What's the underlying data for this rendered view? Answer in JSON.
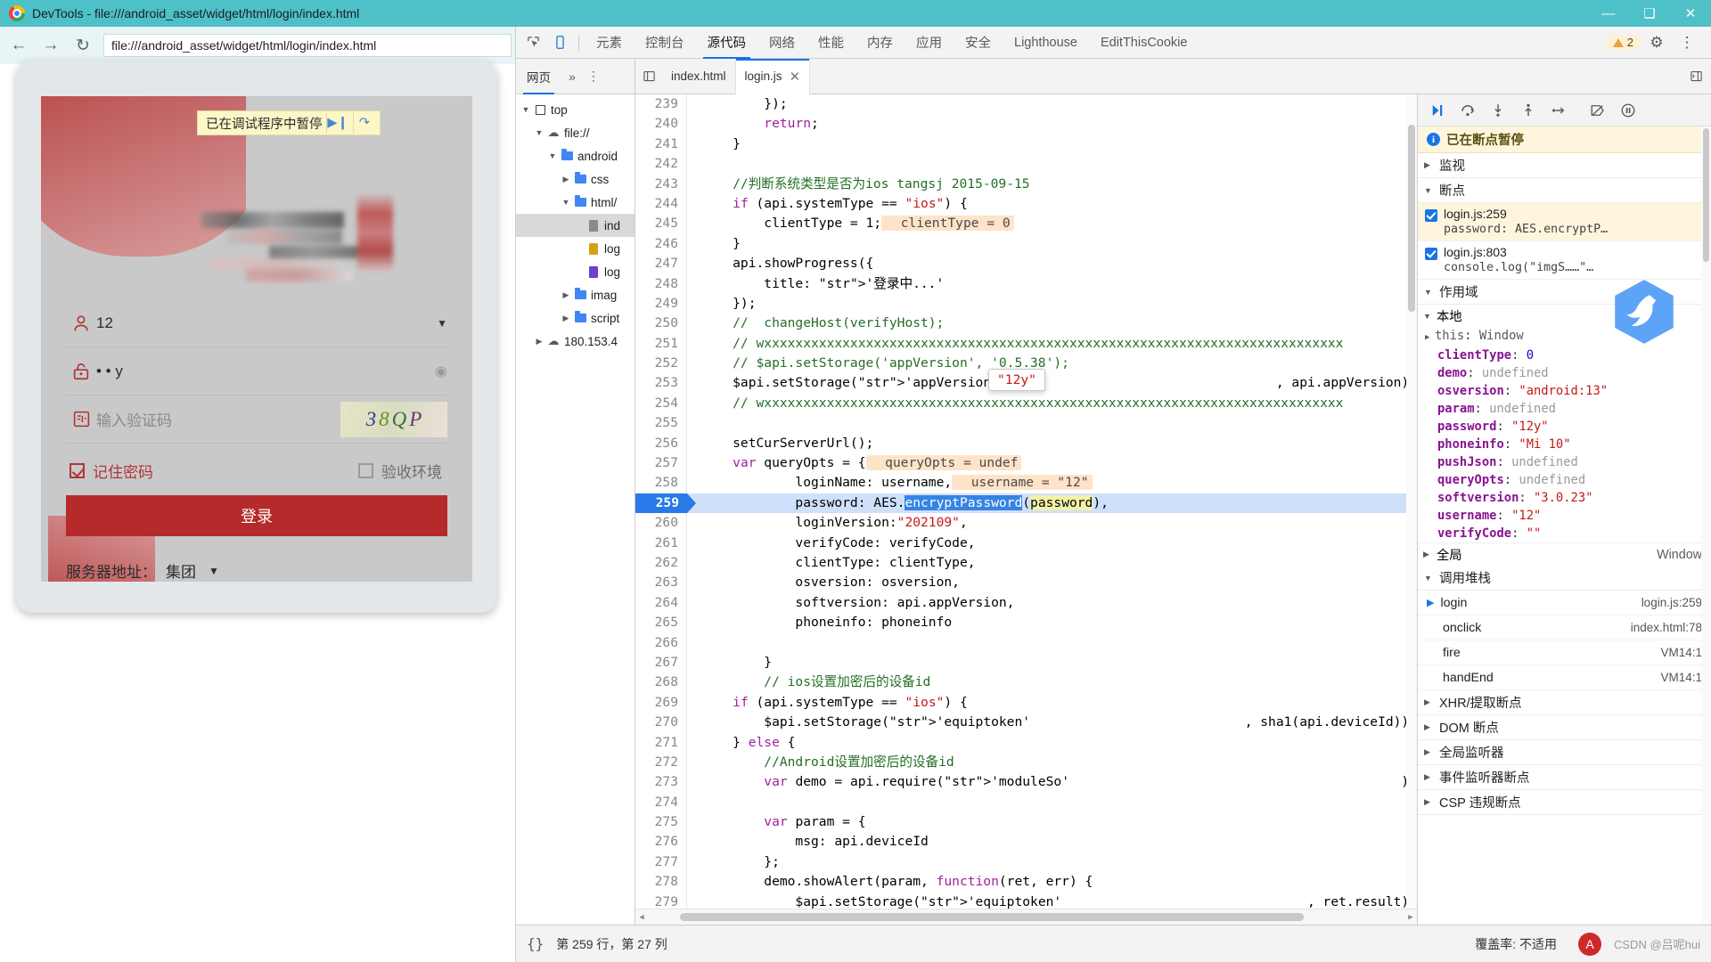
{
  "window": {
    "title": "DevTools - file:///android_asset/widget/html/login/index.html",
    "minimize": "—",
    "maximize": "❑",
    "close": "✕"
  },
  "browser": {
    "back": "←",
    "forward": "→",
    "reload": "↻",
    "url": "file:///android_asset/widget/html/login/index.html"
  },
  "devtools": {
    "inspect_icon": "inspect",
    "device_icon": "device",
    "tabs": [
      {
        "label": "元素",
        "active": false
      },
      {
        "label": "控制台",
        "active": false
      },
      {
        "label": "源代码",
        "active": true
      },
      {
        "label": "网络",
        "active": false
      },
      {
        "label": "性能",
        "active": false
      },
      {
        "label": "内存",
        "active": false
      },
      {
        "label": "应用",
        "active": false
      },
      {
        "label": "安全",
        "active": false
      },
      {
        "label": "Lighthouse",
        "active": false
      },
      {
        "label": "EditThisCookie",
        "active": false
      }
    ],
    "warning_count": "2",
    "settings_icon": "⚙",
    "more_icon": "⋮"
  },
  "sources": {
    "nav_tab": "网页",
    "nav_more": "»",
    "nav_menu": "⋮",
    "show_nav_icon": "◱",
    "show_dbg_icon": "◰",
    "file_tabs": [
      {
        "label": "index.html",
        "active": false,
        "closable": false
      },
      {
        "label": "login.js",
        "active": true,
        "closable": true,
        "close": "✕"
      }
    ],
    "tree": [
      {
        "indent": 0,
        "tri": "▼",
        "icon": "frame",
        "label": "top"
      },
      {
        "indent": 1,
        "tri": "▼",
        "icon": "cloud",
        "label": "file://"
      },
      {
        "indent": 2,
        "tri": "▼",
        "icon": "folder",
        "label": "android"
      },
      {
        "indent": 3,
        "tri": "▶",
        "icon": "folder",
        "label": "css"
      },
      {
        "indent": 3,
        "tri": "▼",
        "icon": "folder",
        "label": "html/"
      },
      {
        "indent": 4,
        "tri": "",
        "icon": "doc-grey",
        "label": "ind",
        "selected": true
      },
      {
        "indent": 4,
        "tri": "",
        "icon": "doc-yellow",
        "label": "log"
      },
      {
        "indent": 4,
        "tri": "",
        "icon": "doc-purple",
        "label": "log"
      },
      {
        "indent": 3,
        "tri": "▶",
        "icon": "folder",
        "label": "imag"
      },
      {
        "indent": 3,
        "tri": "▶",
        "icon": "folder",
        "label": "script"
      },
      {
        "indent": 1,
        "tri": "▶",
        "icon": "cloud",
        "label": "180.153.4"
      }
    ],
    "code_lines": [
      {
        "n": "239",
        "text": "        });"
      },
      {
        "n": "240",
        "text": "        return;"
      },
      {
        "n": "241",
        "text": "    }"
      },
      {
        "n": "242",
        "text": ""
      },
      {
        "n": "243",
        "text": "    //判断系统类型是否为ios tangsj 2015-09-15",
        "style": "comment"
      },
      {
        "n": "244",
        "text": "    if (api.systemType == \"ios\") {"
      },
      {
        "n": "245",
        "text": "        clientType = 1;",
        "inline": "clientType = 0"
      },
      {
        "n": "246",
        "text": "    }"
      },
      {
        "n": "247",
        "text": "    api.showProgress({"
      },
      {
        "n": "248",
        "text": "        title: '登录中...'"
      },
      {
        "n": "249",
        "text": "    });"
      },
      {
        "n": "250",
        "text": "    //  changeHost(verifyHost);",
        "style": "comment"
      },
      {
        "n": "251",
        "text": "    // wxxxxxxxxxxxxxxxxxxxxxxxxxxxxxxxxxxxxxxxxxxxxxxxxxxxxxxxxxxxxxxxxxxxxxxxxxx",
        "style": "comment"
      },
      {
        "n": "252",
        "text": "    // $api.setStorage('appVersion', '0.5.38');",
        "style": "comment"
      },
      {
        "n": "253",
        "text": "    $api.setStorage('appVersion', api.appVersion);"
      },
      {
        "n": "254",
        "text": "    // wxxxxxxxxxxxxxxxxxxxxxxxxxxxxxxxxxxxxxxxxxxxxxxxxxxxxxxxxxxxxxxxxxxxxxxxxxx",
        "style": "comment"
      },
      {
        "n": "255",
        "text": ""
      },
      {
        "n": "256",
        "text": "    setCurServerUrl();"
      },
      {
        "n": "257",
        "text": "    var queryOpts = {",
        "inline": "queryOpts = undef"
      },
      {
        "n": "258",
        "text": "            loginName: username,",
        "inline": "username = \"12\""
      },
      {
        "n": "259",
        "text": "            password: AES.encryptPassword(password),",
        "highlighted": true
      },
      {
        "n": "260",
        "text": "            loginVersion:\"202109\","
      },
      {
        "n": "261",
        "text": "            verifyCode: verifyCode,"
      },
      {
        "n": "262",
        "text": "            clientType: clientType,"
      },
      {
        "n": "263",
        "text": "            osversion: osversion,"
      },
      {
        "n": "264",
        "text": "            softversion: api.appVersion,"
      },
      {
        "n": "265",
        "text": "            phoneinfo: phoneinfo"
      },
      {
        "n": "266",
        "text": ""
      },
      {
        "n": "267",
        "text": "        }"
      },
      {
        "n": "268",
        "text": "        // ios设置加密后的设备id",
        "style": "comment"
      },
      {
        "n": "269",
        "text": "    if (api.systemType == \"ios\") {"
      },
      {
        "n": "270",
        "text": "        $api.setStorage('equiptoken', sha1(api.deviceId));"
      },
      {
        "n": "271",
        "text": "    } else {"
      },
      {
        "n": "272",
        "text": "        //Android设置加密后的设备id",
        "style": "comment"
      },
      {
        "n": "273",
        "text": "        var demo = api.require('moduleSo');"
      },
      {
        "n": "274",
        "text": ""
      },
      {
        "n": "275",
        "text": "        var param = {"
      },
      {
        "n": "276",
        "text": "            msg: api.deviceId"
      },
      {
        "n": "277",
        "text": "        };"
      },
      {
        "n": "278",
        "text": "        demo.showAlert(param, function(ret, err) {"
      },
      {
        "n": "279",
        "text": "            $api.setStorage('equiptoken', ret.result);"
      }
    ],
    "tooltip": "\"12y\"",
    "status": {
      "format_icon": "{}",
      "cursor": "第 259 行，第 27 列",
      "coverage_label": "覆盖率: 不适用",
      "badge": "A"
    }
  },
  "debugger": {
    "toolbar": [
      {
        "name": "resume-button",
        "glyph": "▶❙"
      },
      {
        "name": "step-over-button",
        "glyph": "↷"
      },
      {
        "name": "step-into-button",
        "glyph": "↓"
      },
      {
        "name": "step-out-button",
        "glyph": "↑"
      },
      {
        "name": "step-button",
        "glyph": "⇥"
      },
      {
        "name": "deactivate-breakpoints-button",
        "glyph": "⧉"
      },
      {
        "name": "pause-on-exceptions-button",
        "glyph": "❚❚"
      }
    ],
    "paused_banner": "已在断点暂停",
    "sections": {
      "watch": "监视",
      "breakpoints": "断点",
      "scope": "作用域",
      "local": "本地",
      "global": "全局",
      "global_value": "Window",
      "callstack": "调用堆栈",
      "xhr": "XHR/提取断点",
      "dom": "DOM 断点",
      "global_listeners": "全局监听器",
      "event_listeners": "事件监听器断点",
      "csp": "CSP 违规断点"
    },
    "breakpoints": [
      {
        "location": "login.js:259",
        "source": "password: AES.encryptP…",
        "checked": true,
        "selected": true
      },
      {
        "location": "login.js:803",
        "source": "console.log(\"imgS……\"…",
        "checked": true,
        "selected": false
      }
    ],
    "scope_vars": [
      {
        "name": "this",
        "value": "Window",
        "kind": "obj",
        "expandable": true
      },
      {
        "name": "clientType",
        "value": "0",
        "kind": "num"
      },
      {
        "name": "demo",
        "value": "undefined",
        "kind": "undef"
      },
      {
        "name": "osversion",
        "value": "\"android:13\"",
        "kind": "str"
      },
      {
        "name": "param",
        "value": "undefined",
        "kind": "undef"
      },
      {
        "name": "password",
        "value": "\"12y\"",
        "kind": "str"
      },
      {
        "name": "phoneinfo",
        "value": "\"Mi 10\"",
        "kind": "str"
      },
      {
        "name": "pushJson",
        "value": "undefined",
        "kind": "undef"
      },
      {
        "name": "queryOpts",
        "value": "undefined",
        "kind": "undef"
      },
      {
        "name": "softversion",
        "value": "\"3.0.23\"",
        "kind": "str"
      },
      {
        "name": "username",
        "value": "\"12\"",
        "kind": "str"
      },
      {
        "name": "verifyCode",
        "value": "\"\"",
        "kind": "str"
      }
    ],
    "callstack": [
      {
        "fn": "login",
        "loc": "login.js:259",
        "current": true
      },
      {
        "fn": "onclick",
        "loc": "index.html:78",
        "current": false
      },
      {
        "fn": "fire",
        "loc": "VM14:1",
        "current": false
      },
      {
        "fn": "handEnd",
        "loc": "VM14:1",
        "current": false
      }
    ]
  },
  "phone": {
    "paused_banner": "已在调试程序中暂停",
    "resume_glyph": "▶❙",
    "step_glyph": "↷",
    "username_value": "12",
    "password_value": "• • y",
    "captcha_placeholder": "输入验证码",
    "captcha_chars": [
      "3",
      "8",
      "Q",
      "P"
    ],
    "remember_label": "记住密码",
    "remember_checked": true,
    "env_label": "验收环境",
    "env_checked": false,
    "login_button": "登录",
    "server_label": "服务器地址：",
    "server_value": "集团",
    "dropdown_glyph": "▼",
    "eye_glyph": "◉"
  },
  "watermark": "CSDN @吕呢hui"
}
